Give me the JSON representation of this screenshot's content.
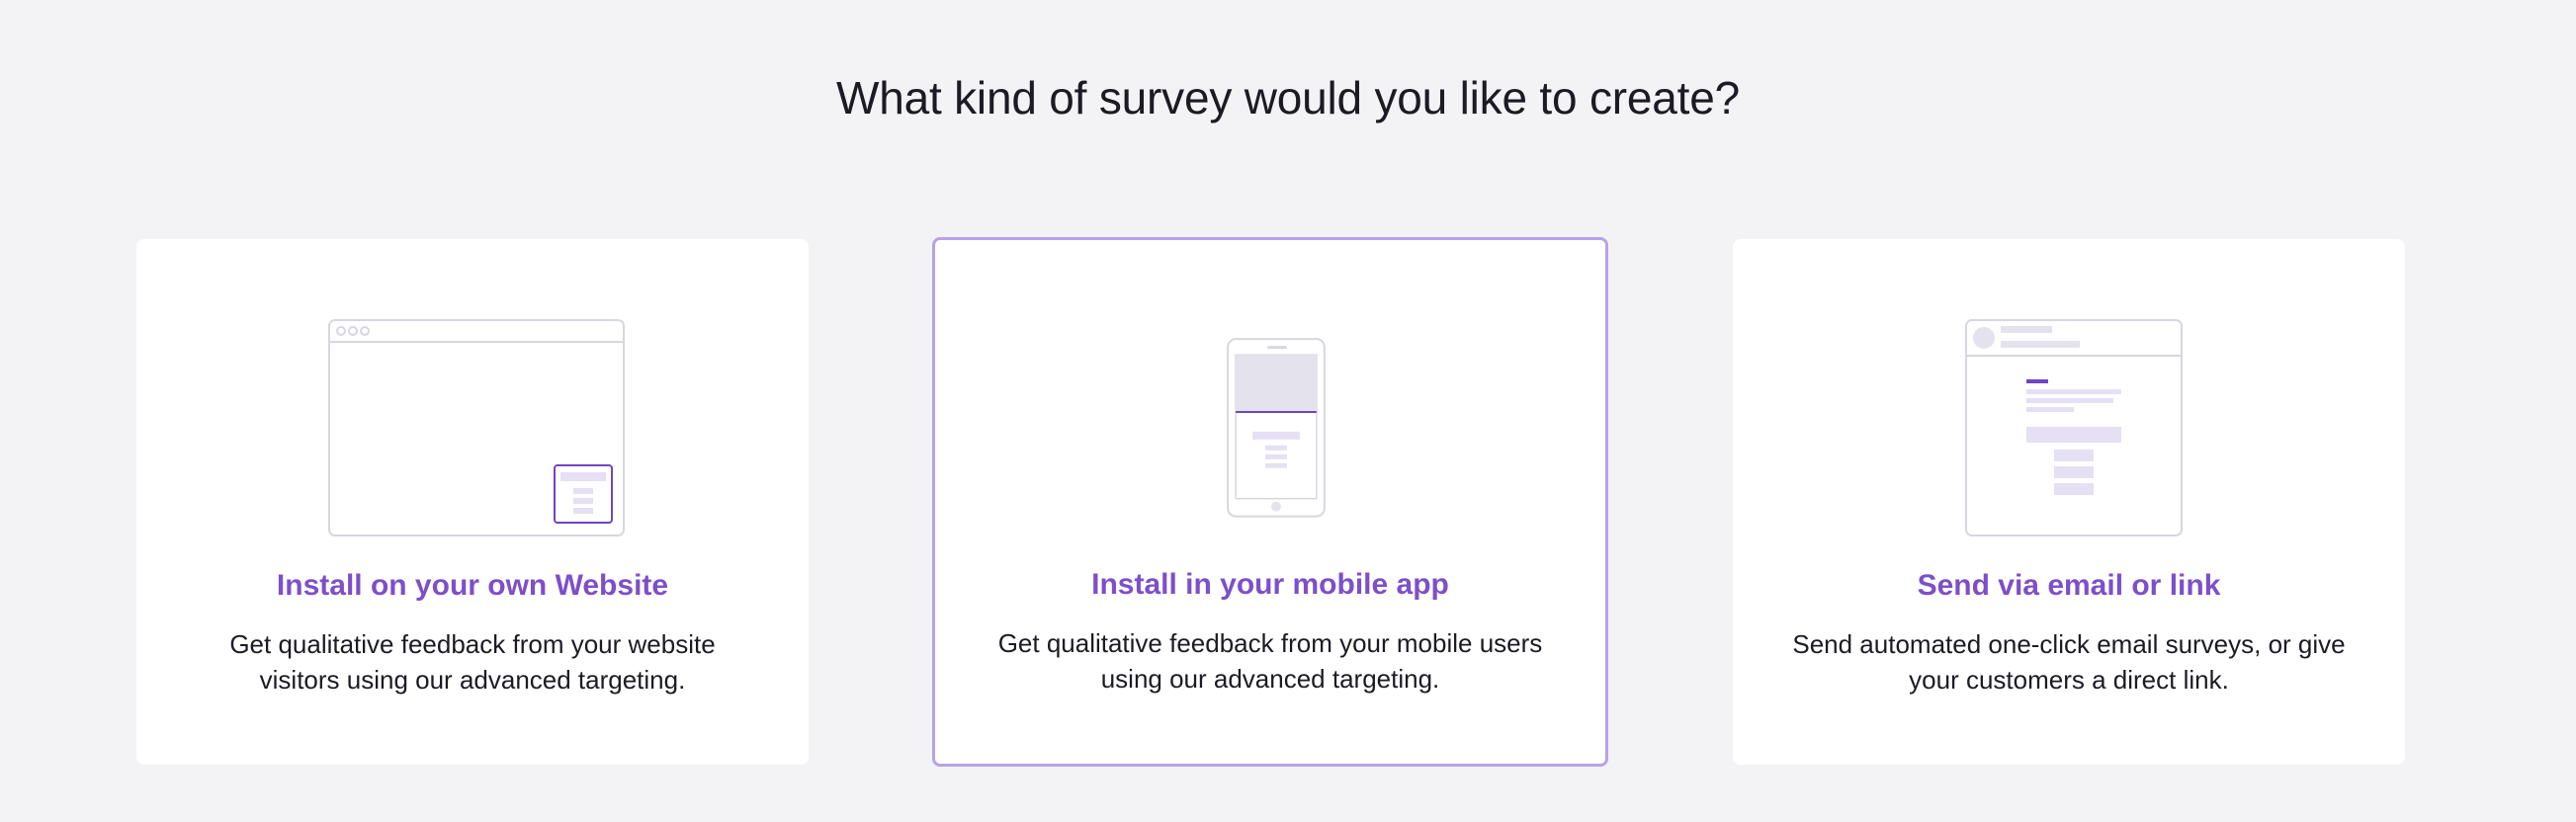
{
  "page": {
    "title": "What kind of survey would you like to create?"
  },
  "cards": [
    {
      "title": "Install on your own Website",
      "description": "Get qualitative feedback from your website visitors using our advanced targeting.",
      "illustration": "browser-window-icon",
      "selected": false
    },
    {
      "title": "Install in your mobile app",
      "description": "Get qualitative feedback from your mobile users using our advanced targeting.",
      "illustration": "mobile-phone-icon",
      "selected": true
    },
    {
      "title": "Send via email or link",
      "description": "Send automated one-click email surveys, or give your customers a direct link.",
      "illustration": "email-message-icon",
      "selected": false
    }
  ],
  "colors": {
    "background": "#f3f3f5",
    "accent": "#7d4fc9",
    "selected_border": "#b7a2ea",
    "illustration_line": "#d8d6df",
    "illustration_fill": "#e6e0f4"
  }
}
